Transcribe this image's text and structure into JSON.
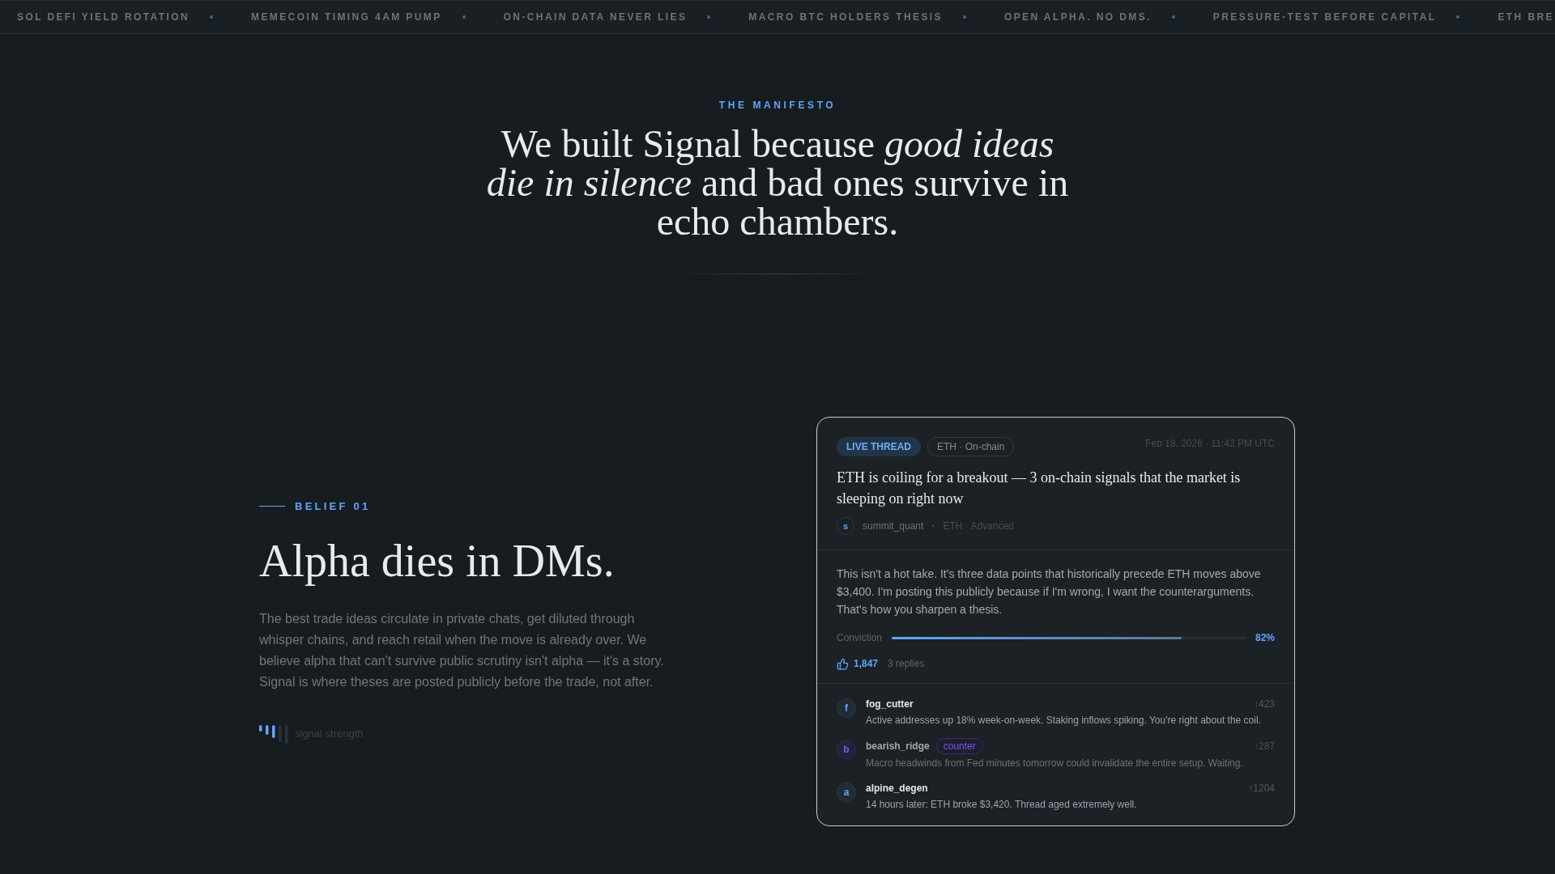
{
  "ticker": {
    "items": [
      "SOL DEFI YIELD ROTATION",
      "MEMECOIN TIMING 4AM PUMP",
      "ON-CHAIN DATA NEVER LIES",
      "MACRO BTC HOLDERS THESIS",
      "OPEN ALPHA. NO DMS.",
      "PRESSURE-TEST BEFORE CAPITAL",
      "ETH BRE"
    ]
  },
  "manifesto": {
    "eyebrow": "THE MANIFESTO",
    "headline": "We built Signal because *good ideas die in silence* and bad ones survive in echo chambers."
  },
  "belief": {
    "eyebrow": "BELIEF 01",
    "title": "Alpha dies in DMs.",
    "body": "The best trade ideas circulate in private chats, get diluted through whisper chains, and reach retail when the move is already over. We believe alpha that can't survive public scrutiny isn't alpha — it's a story. Signal is where theses are posted publicly before the trade, not after.",
    "signal_label": "signal strength"
  },
  "thread_card": {
    "badge": "LIVE THREAD",
    "tag": "ETH · On-chain",
    "timestamp": "Feb 18, 2026 · 11:42 PM UTC",
    "title": "ETH is coiling for a breakout — 3 on-chain signals that the market is sleeping on right now",
    "author": {
      "initial": "s",
      "name": "summit_quant",
      "separator": "·",
      "meta": "ETH · Advanced"
    },
    "body": "This isn't a hot take. It's three data points that historically precede ETH moves above $3,400. I'm posting this publicly because if I'm wrong, I want the counterarguments. That's how you sharpen a thesis.",
    "conviction": {
      "label": "Conviction",
      "level": 0.82,
      "reading": "82%"
    },
    "likes": "1,847",
    "replies_count": "3 replies",
    "replies": [
      {
        "kind": "reply",
        "initial": "f",
        "name": "fog_cutter",
        "votes": "↑423",
        "text": "Active addresses up 18% week-on-week. Staking inflows spiking. You're right about the coil."
      },
      {
        "kind": "counter",
        "initial": "b",
        "name": "bearish_ridge",
        "badge": "counter",
        "votes": "↑287",
        "text": "Macro headwinds from Fed minutes tomorrow could invalidate the entire setup. Waiting."
      },
      {
        "kind": "reply",
        "initial": "a",
        "name": "alpine_degen",
        "votes": "↑1204",
        "text": "14 hours later: ETH broke $3,420. Thread aged extremely well."
      }
    ]
  }
}
